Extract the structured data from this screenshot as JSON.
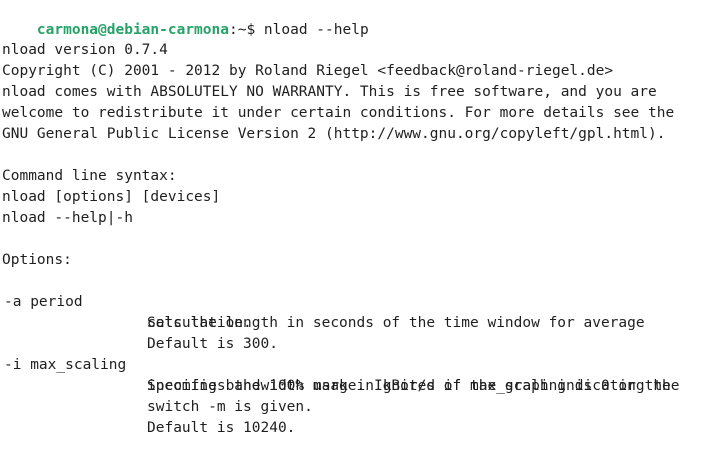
{
  "prompt": {
    "user_host": "carmona@debian-carmona",
    "separator": ":",
    "path": "~",
    "symbol": "$",
    "command": " nload --help"
  },
  "header": {
    "version": "nload version 0.7.4",
    "copyright": "Copyright (C) 2001 - 2012 by Roland Riegel <feedback@roland-riegel.de>",
    "license_1": "nload comes with ABSOLUTELY NO WARRANTY. This is free software, and you are",
    "license_2": "welcome to redistribute it under certain conditions. For more details see the",
    "license_3": "GNU General Public License Version 2 (http://www.gnu.org/copyleft/gpl.html)."
  },
  "syntax": {
    "title": "Command line syntax:",
    "usage_1": "nload [options] [devices]",
    "usage_2": "nload --help|-h"
  },
  "options": {
    "title": "Options:",
    "items": [
      {
        "flag": "-a period",
        "lines": [
          "Sets the length in seconds of the time window for average",
          "calculation.",
          "Default is 300."
        ]
      },
      {
        "flag": "-i max_scaling",
        "lines": [
          "Specifies the 100% mark in kBit/s of the graph indicating the",
          "incoming bandwidth usage. Ignored if max_scaling is 0 or the",
          "switch -m is given.",
          "Default is 10240."
        ]
      }
    ]
  }
}
